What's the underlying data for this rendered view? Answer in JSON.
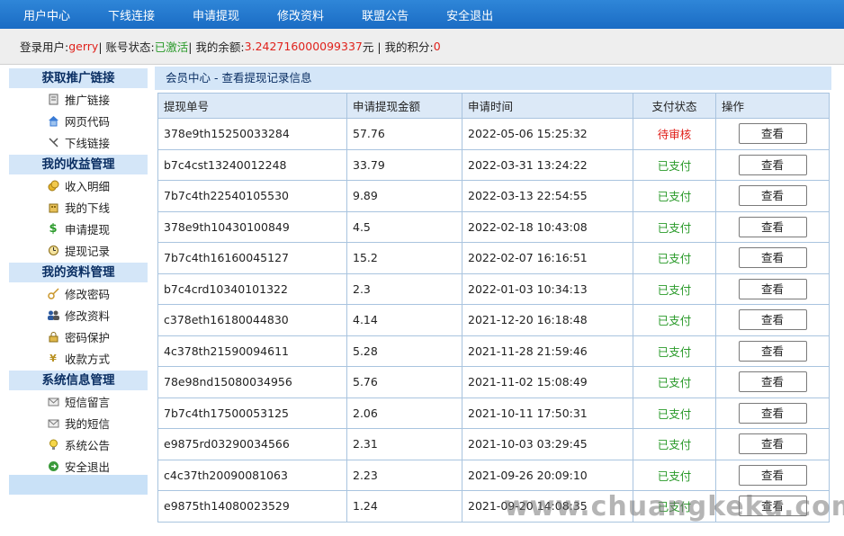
{
  "topnav": {
    "items": [
      "用户中心",
      "下线连接",
      "申请提现",
      "修改资料",
      "联盟公告",
      "安全退出"
    ]
  },
  "info": {
    "user_label": "登录用户:",
    "username": "gerry",
    "status_label": " | 账号状态:",
    "status": "已激活",
    "balance_label": " | 我的余额: ",
    "balance": "3.242716000099337",
    "balance_unit": " 元 | 我的积分: ",
    "points": "0"
  },
  "sidebar": {
    "sections": [
      {
        "title": "获取推广链接",
        "items": [
          {
            "label": "推广链接",
            "icon": "document-icon"
          },
          {
            "label": "网页代码",
            "icon": "home-icon"
          },
          {
            "label": "下线链接",
            "icon": "tools-icon"
          }
        ]
      },
      {
        "title": "我的收益管理",
        "items": [
          {
            "label": "收入明细",
            "icon": "coins-icon"
          },
          {
            "label": "我的下线",
            "icon": "building-icon"
          },
          {
            "label": "申请提现",
            "icon": "dollar-icon"
          },
          {
            "label": "提现记录",
            "icon": "clock-icon"
          }
        ]
      },
      {
        "title": "我的资料管理",
        "items": [
          {
            "label": "修改密码",
            "icon": "key-icon"
          },
          {
            "label": "修改资料",
            "icon": "users-icon"
          },
          {
            "label": "密码保护",
            "icon": "lock-icon"
          },
          {
            "label": "收款方式",
            "icon": "yen-icon"
          }
        ]
      },
      {
        "title": "系统信息管理",
        "items": [
          {
            "label": "短信留言",
            "icon": "mail-icon"
          },
          {
            "label": "我的短信",
            "icon": "mail-icon"
          },
          {
            "label": "系统公告",
            "icon": "bulb-icon"
          },
          {
            "label": "安全退出",
            "icon": "exit-icon"
          }
        ]
      }
    ]
  },
  "content": {
    "header": "会员中心 - 查看提现记录信息",
    "columns": [
      "提现单号",
      "申请提现金额",
      "申请时间",
      "支付状态",
      "操作"
    ],
    "rows": [
      {
        "id": "378e9th15250033284",
        "amount": "57.76",
        "time": "2022-05-06 15:25:32",
        "status": "待审核",
        "action": "查看"
      },
      {
        "id": "b7c4cst13240012248",
        "amount": "33.79",
        "time": "2022-03-31 13:24:22",
        "status": "已支付",
        "action": "查看"
      },
      {
        "id": "7b7c4th22540105530",
        "amount": "9.89",
        "time": "2022-03-13 22:54:55",
        "status": "已支付",
        "action": "查看"
      },
      {
        "id": "378e9th10430100849",
        "amount": "4.5",
        "time": "2022-02-18 10:43:08",
        "status": "已支付",
        "action": "查看"
      },
      {
        "id": "7b7c4th16160045127",
        "amount": "15.2",
        "time": "2022-02-07 16:16:51",
        "status": "已支付",
        "action": "查看"
      },
      {
        "id": "b7c4crd10340101322",
        "amount": "2.3",
        "time": "2022-01-03 10:34:13",
        "status": "已支付",
        "action": "查看"
      },
      {
        "id": "c378eth16180044830",
        "amount": "4.14",
        "time": "2021-12-20 16:18:48",
        "status": "已支付",
        "action": "查看"
      },
      {
        "id": "4c378th21590094611",
        "amount": "5.28",
        "time": "2021-11-28 21:59:46",
        "status": "已支付",
        "action": "查看"
      },
      {
        "id": "78e98nd15080034956",
        "amount": "5.76",
        "time": "2021-11-02 15:08:49",
        "status": "已支付",
        "action": "查看"
      },
      {
        "id": "7b7c4th17500053125",
        "amount": "2.06",
        "time": "2021-10-11 17:50:31",
        "status": "已支付",
        "action": "查看"
      },
      {
        "id": "e9875rd03290034566",
        "amount": "2.31",
        "time": "2021-10-03 03:29:45",
        "status": "已支付",
        "action": "查看"
      },
      {
        "id": "c4c37th20090081063",
        "amount": "2.23",
        "time": "2021-09-26 20:09:10",
        "status": "已支付",
        "action": "查看"
      },
      {
        "id": "e9875th14080023529",
        "amount": "1.24",
        "time": "2021-09-20 14:08:35",
        "status": "已支付",
        "action": "查看"
      }
    ]
  },
  "watermark": "www.chuangkeku.com",
  "colors": {
    "nav_bg": "#1a6cc4",
    "pending": "#e0221c",
    "paid": "#2a9a2a",
    "section_bg": "#d4e6f8"
  }
}
